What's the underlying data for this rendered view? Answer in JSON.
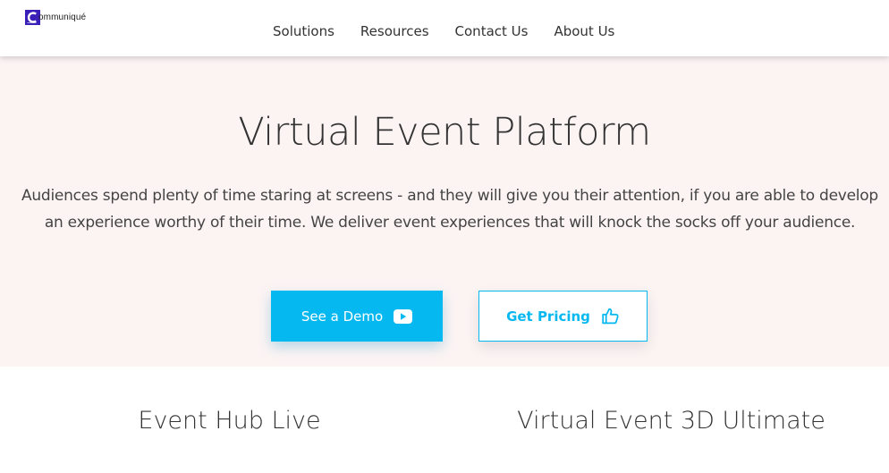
{
  "header": {
    "logo_text": "ommuniqué",
    "nav": [
      "Solutions",
      "Resources",
      "Contact Us",
      "About Us"
    ]
  },
  "hero": {
    "title": "Virtual Event Platform",
    "description": "Audiences spend plenty of time staring at screens - and they will give you their attention, if you are able to develop an experience worthy of their time. We deliver event experiences that will knock the socks off your audience.",
    "demo_button": {
      "label": "See a Demo",
      "icon": "play-icon"
    },
    "pricing_button": {
      "label": "Get Pricing",
      "icon": "thumbs-up-icon"
    }
  },
  "products": [
    "Event Hub Live",
    "Virtual Event 3D Ultimate"
  ],
  "colors": {
    "accent": "#06b8f0",
    "hero_background": "#fcf4f3",
    "logo_blue": "#3a1fb8",
    "text": "#333333"
  }
}
